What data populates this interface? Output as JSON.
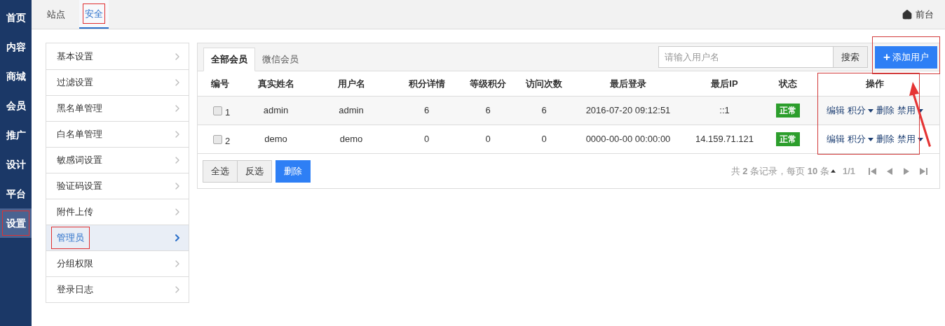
{
  "nav": [
    {
      "label": "首页",
      "selected": false,
      "annotated": false
    },
    {
      "label": "内容",
      "selected": false,
      "annotated": false
    },
    {
      "label": "商城",
      "selected": false,
      "annotated": false
    },
    {
      "label": "会员",
      "selected": false,
      "annotated": false
    },
    {
      "label": "推广",
      "selected": false,
      "annotated": false
    },
    {
      "label": "设计",
      "selected": false,
      "annotated": false
    },
    {
      "label": "平台",
      "selected": false,
      "annotated": false
    },
    {
      "label": "设置",
      "selected": true,
      "annotated": true
    }
  ],
  "top_tabs": [
    {
      "label": "站点",
      "selected": false,
      "annotated": false
    },
    {
      "label": "安全",
      "selected": true,
      "annotated": true
    }
  ],
  "frontend_link": "前台",
  "menu": [
    {
      "label": "基本设置",
      "selected": false,
      "annotated": false
    },
    {
      "label": "过滤设置",
      "selected": false,
      "annotated": false
    },
    {
      "label": "黑名单管理",
      "selected": false,
      "annotated": false
    },
    {
      "label": "白名单管理",
      "selected": false,
      "annotated": false
    },
    {
      "label": "敏感词设置",
      "selected": false,
      "annotated": false
    },
    {
      "label": "验证码设置",
      "selected": false,
      "annotated": false
    },
    {
      "label": "附件上传",
      "selected": false,
      "annotated": false
    },
    {
      "label": "管理员",
      "selected": true,
      "annotated": true
    },
    {
      "label": "分组权限",
      "selected": false,
      "annotated": false
    },
    {
      "label": "登录日志",
      "selected": false,
      "annotated": false
    }
  ],
  "member_tabs": [
    {
      "label": "全部会员",
      "selected": true
    },
    {
      "label": "微信会员",
      "selected": false
    }
  ],
  "search": {
    "placeholder": "请输入用户名",
    "button": "搜索"
  },
  "add_button": {
    "icon": "+",
    "label": "添加用户",
    "annotated": true
  },
  "pointer_arrow": true,
  "table": {
    "columns": [
      "编号",
      "真实姓名",
      "用户名",
      "积分详情",
      "等级积分",
      "访问次数",
      "最后登录",
      "最后IP",
      "状态",
      "操作"
    ],
    "actions_annotated": true,
    "rows": [
      {
        "checked": false,
        "id": "1",
        "real_name": "admin",
        "username": "admin",
        "points": "6",
        "level_points": "6",
        "visits": "6",
        "last_login": "2016-07-20 09:12:51",
        "last_ip": "::1",
        "status": {
          "label": "正常",
          "color": "#2c9e2c"
        },
        "actions": [
          {
            "label": "编辑",
            "dropdown": false
          },
          {
            "label": "积分",
            "dropdown": true
          },
          {
            "label": "删除",
            "dropdown": false
          },
          {
            "label": "禁用",
            "dropdown": true
          }
        ]
      },
      {
        "checked": false,
        "id": "2",
        "real_name": "demo",
        "username": "demo",
        "points": "0",
        "level_points": "0",
        "visits": "0",
        "last_login": "0000-00-00 00:00:00",
        "last_ip": "14.159.71.121",
        "status": {
          "label": "正常",
          "color": "#2c9e2c"
        },
        "actions": [
          {
            "label": "编辑",
            "dropdown": false
          },
          {
            "label": "积分",
            "dropdown": true
          },
          {
            "label": "删除",
            "dropdown": false
          },
          {
            "label": "禁用",
            "dropdown": true
          }
        ]
      }
    ]
  },
  "bulk_buttons": [
    {
      "label": "全选",
      "kind": "default"
    },
    {
      "label": "反选",
      "kind": "default"
    },
    {
      "label": "删除",
      "kind": "primary"
    }
  ],
  "pagination": {
    "summary": "共 **2** 条记录，每页 **10** 条",
    "page": "1/1"
  }
}
